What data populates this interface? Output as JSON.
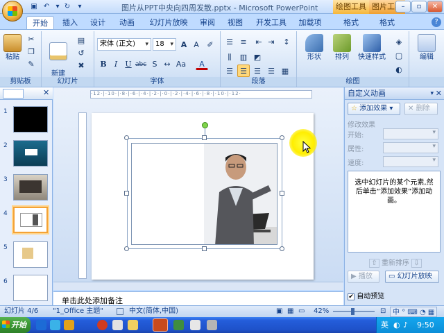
{
  "window": {
    "title": "图片从PPT中央向四周发散.pptx - Microsoft PowerPoint",
    "context_tabs": [
      "绘图工具",
      "图片工具"
    ]
  },
  "tabs": [
    "开始",
    "插入",
    "设计",
    "动画",
    "幻灯片放映",
    "审阅",
    "视图",
    "开发工具",
    "加载项",
    "格式",
    "格式"
  ],
  "ribbon": {
    "groups": {
      "clipboard": "剪贴板",
      "slides": "幻灯片",
      "font": "字体",
      "paragraph": "段落",
      "drawing": "绘图",
      "editing": ""
    },
    "paste_label": "粘贴",
    "new_slide_label": "新建\n幻灯片",
    "font_name": "宋体 (正文)",
    "font_size": "18",
    "shape_label": "形状",
    "arrange_label": "排列",
    "quick_styles_label": "快速样式",
    "editing_label": "编辑"
  },
  "slides": [
    {
      "num": "1"
    },
    {
      "num": "2"
    },
    {
      "num": "3"
    },
    {
      "num": "4"
    },
    {
      "num": "5"
    },
    {
      "num": "6"
    }
  ],
  "ruler": {
    "h_marks": "·12·|·10·|·8·|·6·|·4·|·2·|·0·|·2·|·4·|·6·|·8·|·10·|·12·"
  },
  "notes": {
    "placeholder": "单击此处添加备注"
  },
  "taskpane": {
    "title": "自定义动画",
    "add_effect": "添加效果",
    "remove": "删除",
    "modify_effect": "修改效果",
    "start_label": "开始:",
    "property_label": "属性:",
    "speed_label": "速度:",
    "hint": "选中幻灯片的某个元素,然后单击“添加效果”添加动画。",
    "reorder": "重新排序",
    "play": "播放",
    "slideshow": "幻灯片放映",
    "autopreview": "自动预览"
  },
  "status": {
    "slide_info": "幻灯片 4/6",
    "theme": "\"1_Office 主题\"",
    "language": "中文(简体,中国)",
    "zoom": "42%"
  },
  "taskbar": {
    "start": "开始",
    "ime": "英",
    "clock": "9:50"
  },
  "colors": {
    "ribbon_blue": "#bfdbff",
    "selection_orange": "#f4a236",
    "cursor_highlight": "#ffee00"
  }
}
